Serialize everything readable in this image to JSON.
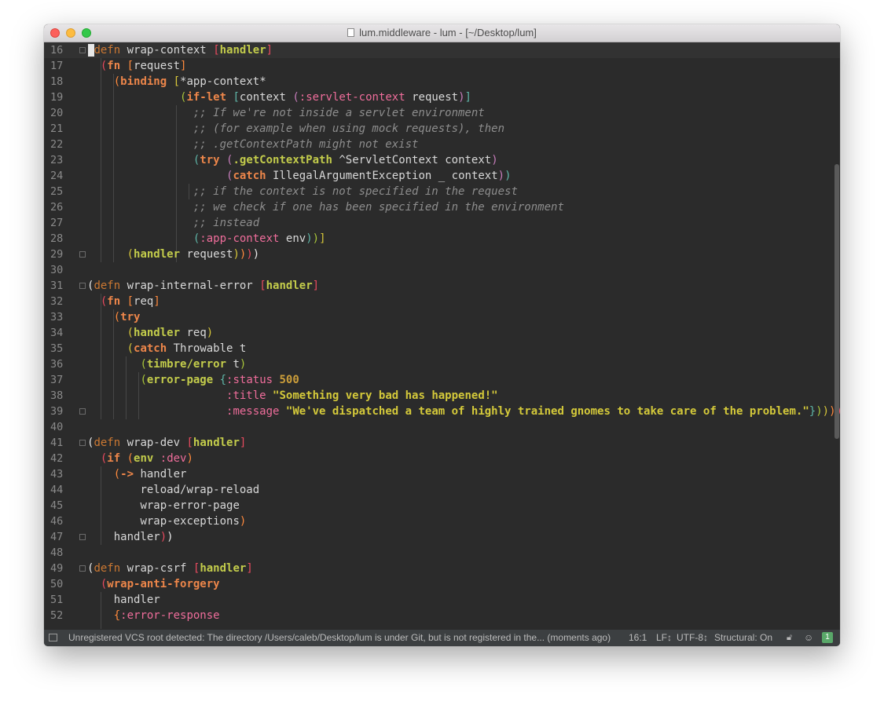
{
  "window": {
    "title": "lum.middleware - lum - [~/Desktop/lum]"
  },
  "editor": {
    "lines": [
      {
        "n": "16",
        "text": "(defn wrap-context [handler]"
      },
      {
        "n": "17",
        "text": "  (fn [request]"
      },
      {
        "n": "18",
        "text": "    (binding [*app-context*"
      },
      {
        "n": "19",
        "text": "              (if-let [context (:servlet-context request)]"
      },
      {
        "n": "20",
        "text": "                ;; If we're not inside a servlet environment"
      },
      {
        "n": "21",
        "text": "                ;; (for example when using mock requests), then"
      },
      {
        "n": "22",
        "text": "                ;; .getContextPath might not exist"
      },
      {
        "n": "23",
        "text": "                (try (.getContextPath ^ServletContext context)"
      },
      {
        "n": "24",
        "text": "                     (catch IllegalArgumentException _ context))"
      },
      {
        "n": "25",
        "text": "                ;; if the context is not specified in the request"
      },
      {
        "n": "26",
        "text": "                ;; we check if one has been specified in the environment"
      },
      {
        "n": "27",
        "text": "                ;; instead"
      },
      {
        "n": "28",
        "text": "                (:app-context env))]"
      },
      {
        "n": "29",
        "text": "      (handler request))))"
      },
      {
        "n": "30",
        "text": ""
      },
      {
        "n": "31",
        "text": "(defn wrap-internal-error [handler]"
      },
      {
        "n": "32",
        "text": "  (fn [req]"
      },
      {
        "n": "33",
        "text": "    (try"
      },
      {
        "n": "34",
        "text": "      (handler req)"
      },
      {
        "n": "35",
        "text": "      (catch Throwable t"
      },
      {
        "n": "36",
        "text": "        (timbre/error t)"
      },
      {
        "n": "37",
        "text": "        (error-page {:status 500"
      },
      {
        "n": "38",
        "text": "                     :title \"Something very bad has happened!\""
      },
      {
        "n": "39",
        "text": "                     :message \"We've dispatched a team of highly trained gnomes to take care of the problem.\"})))))"
      },
      {
        "n": "40",
        "text": ""
      },
      {
        "n": "41",
        "text": "(defn wrap-dev [handler]"
      },
      {
        "n": "42",
        "text": "  (if (env :dev)"
      },
      {
        "n": "43",
        "text": "    (-> handler"
      },
      {
        "n": "44",
        "text": "        reload/wrap-reload"
      },
      {
        "n": "45",
        "text": "        wrap-error-page"
      },
      {
        "n": "46",
        "text": "        wrap-exceptions)"
      },
      {
        "n": "47",
        "text": "    handler))"
      },
      {
        "n": "48",
        "text": ""
      },
      {
        "n": "49",
        "text": "(defn wrap-csrf [handler]"
      },
      {
        "n": "50",
        "text": "  (wrap-anti-forgery"
      },
      {
        "n": "51",
        "text": "    handler"
      },
      {
        "n": "52",
        "text": "    {:error-response"
      }
    ]
  },
  "statusbar": {
    "message": "Unregistered VCS root detected: The directory /Users/caleb/Desktop/lum is under Git, but is not registered in the... (moments ago)",
    "position": "16:1",
    "line_sep": "LF↕",
    "encoding": "UTF-8↕",
    "structural": "Structural: On",
    "notifications": "1"
  },
  "icons": {
    "tool-window": "tool-window-icon",
    "lock": "lock-icon",
    "hector": "hector-icon",
    "event-log": "event-log-icon",
    "analysis-ok": "check-icon"
  },
  "colors": {
    "background": "#2b2b2b",
    "defn": "#cc7832",
    "keyword": "#ef6d9b",
    "builtin": "#c3cc4b",
    "string": "#d4c93a",
    "comment": "#8d8d8d"
  }
}
